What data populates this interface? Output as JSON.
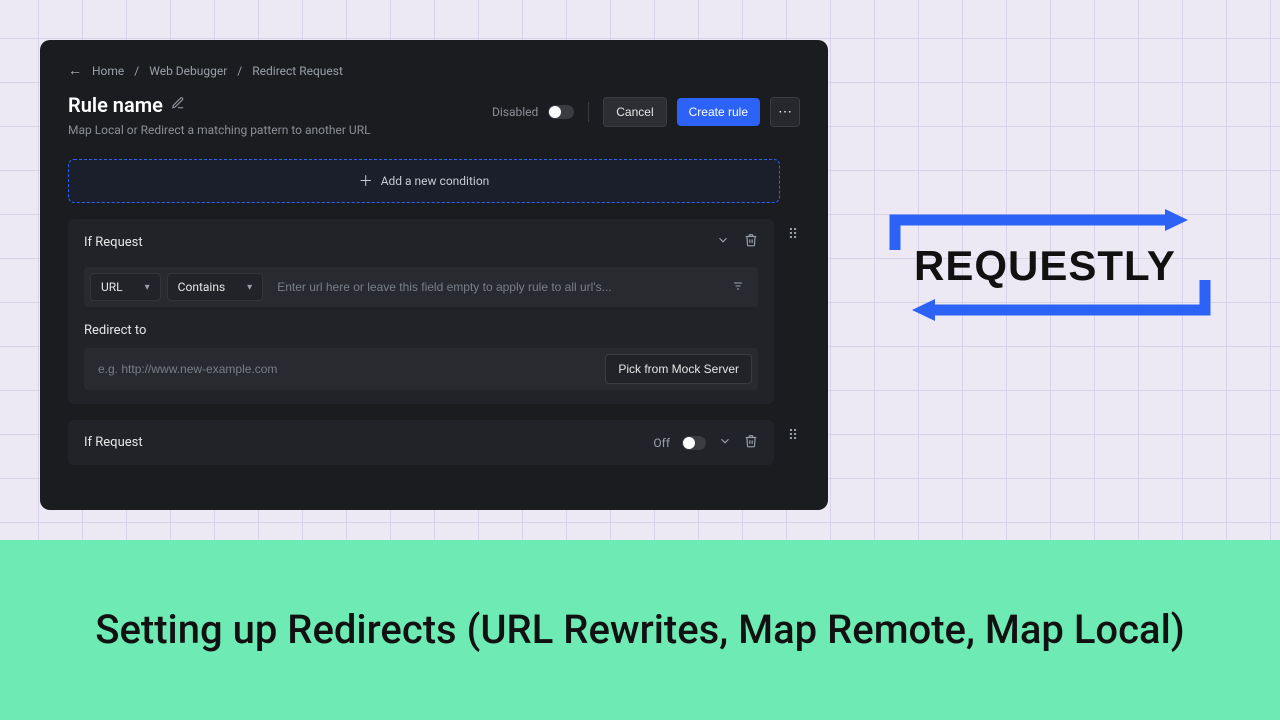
{
  "breadcrumb": {
    "items": [
      "Home",
      "Web Debugger",
      "Redirect Request"
    ]
  },
  "header": {
    "title": "Rule name",
    "subtitle": "Map Local or Redirect a matching pattern to another URL",
    "disabled_label": "Disabled",
    "cancel": "Cancel",
    "create": "Create rule"
  },
  "add_condition_label": "Add a new condition",
  "condition1": {
    "title": "If Request",
    "select_key": "URL",
    "select_op": "Contains",
    "url_placeholder": "Enter url here or leave this field empty to apply rule to all url's...",
    "redirect_label": "Redirect to",
    "redirect_placeholder": "e.g. http://www.new-example.com",
    "pick_label": "Pick from Mock Server"
  },
  "condition2": {
    "title": "If Request",
    "off_label": "Off"
  },
  "logo": {
    "text": "REQUESTLY"
  },
  "caption": "Setting up Redirects (URL Rewrites, Map Remote, Map Local)"
}
